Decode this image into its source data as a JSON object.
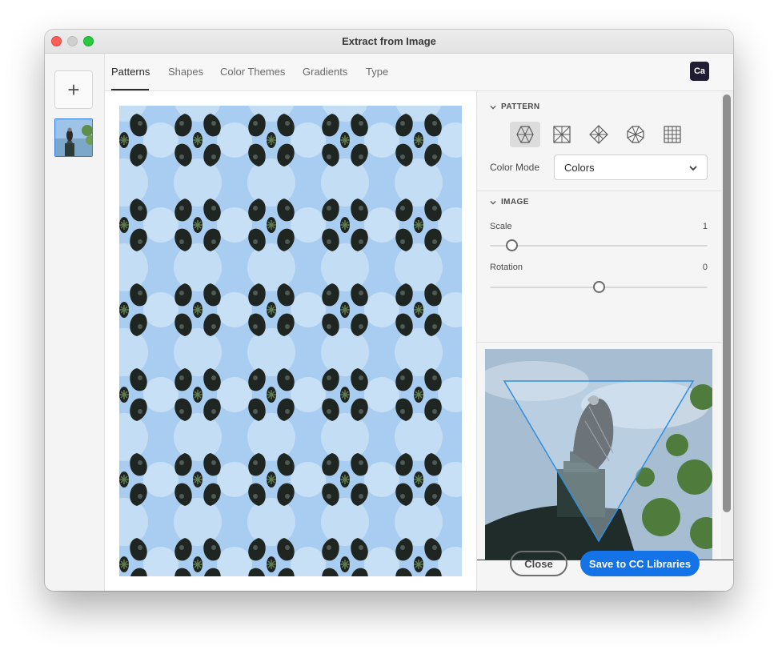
{
  "window": {
    "title": "Extract from Image"
  },
  "left_rail": {
    "add_label": "+"
  },
  "tabs": [
    {
      "label": "Patterns",
      "active": true
    },
    {
      "label": "Shapes",
      "active": false
    },
    {
      "label": "Color Themes",
      "active": false
    },
    {
      "label": "Gradients",
      "active": false
    },
    {
      "label": "Type",
      "active": false
    }
  ],
  "app_logo": {
    "text": "Ca"
  },
  "panel": {
    "pattern_section": {
      "header": "PATTERN",
      "pattern_types": [
        "hexagon-pattern-icon",
        "square-pattern-icon",
        "diamond-pattern-icon",
        "octagon-pattern-icon",
        "grid-pattern-icon"
      ],
      "selected_index": 0,
      "color_mode_label": "Color Mode",
      "color_mode_value": "Colors"
    },
    "image_section": {
      "header": "IMAGE",
      "scale_label": "Scale",
      "scale_value": "1",
      "scale_fraction": 0.1,
      "rotation_label": "Rotation",
      "rotation_value": "0",
      "rotation_fraction": 0.5
    }
  },
  "footer": {
    "close_label": "Close",
    "save_label": "Save to CC Libraries"
  },
  "colors": {
    "accent": "#1473e6",
    "sky": "#a9cdf0",
    "bird": "#1f2622",
    "logo_bg": "#1f1c33"
  }
}
